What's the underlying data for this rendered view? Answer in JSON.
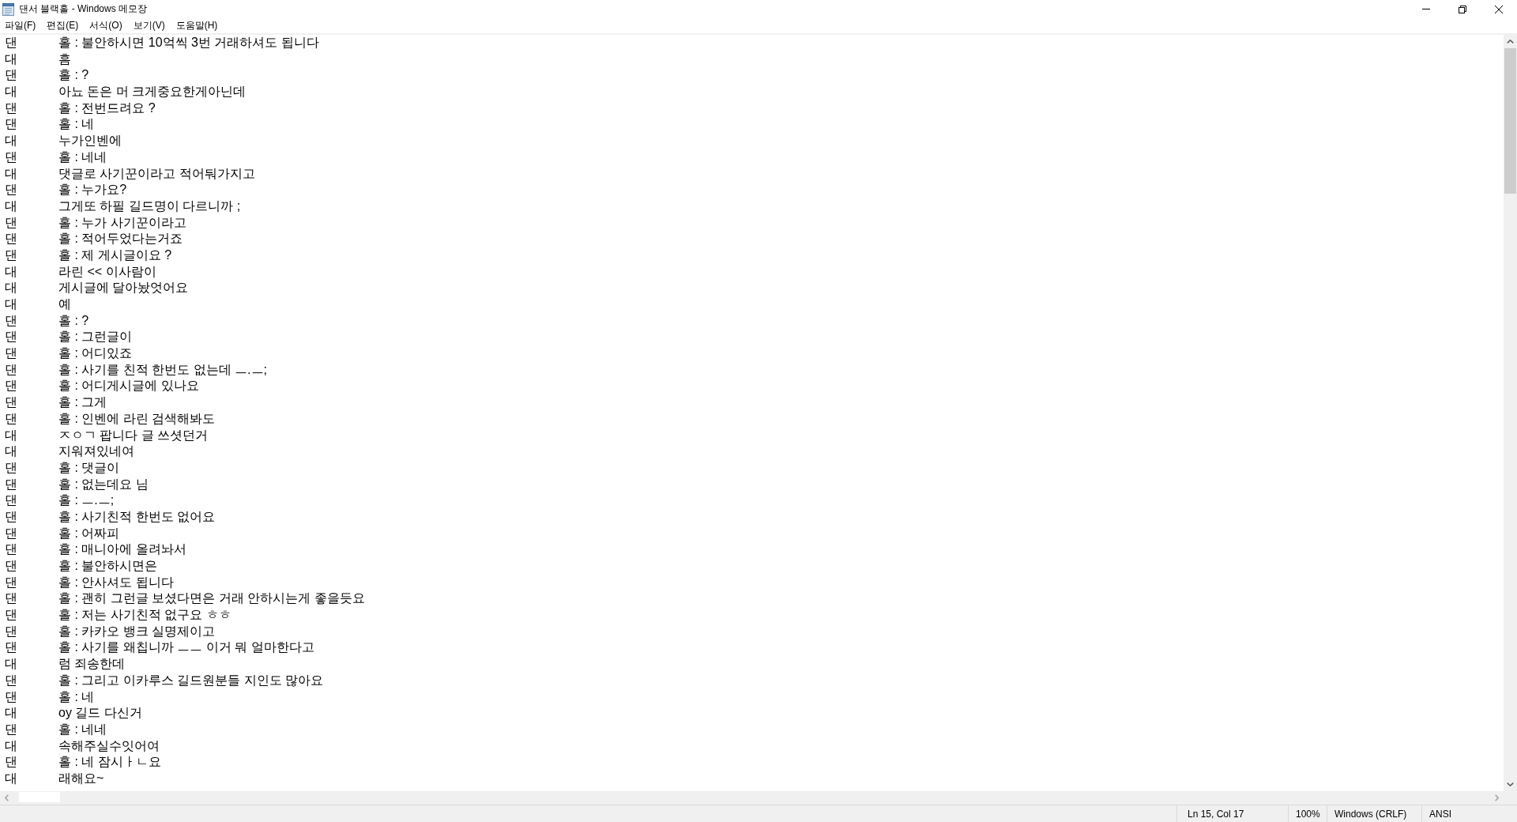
{
  "window": {
    "title": "댄서 블랙홀 - Windows 메모장"
  },
  "menu": [
    "파일(F)",
    "편집(E)",
    "서식(O)",
    "보기(V)",
    "도움말(H)"
  ],
  "lines": [
    {
      "left_text": "댄",
      "right_text": "홀 : 불안하시면 10억씩 3번 거래하셔도 됩니다"
    },
    {
      "left_text": "대",
      "right_text": "흠"
    },
    {
      "left_text": "댄",
      "right_text": "홀 : ?"
    },
    {
      "left_text": "대",
      "right_text": "아뇨 돈은 머 크게중요한게아닌데"
    },
    {
      "left_text": "댄",
      "right_text": "홀 : 전번드려요 ?"
    },
    {
      "left_text": "댄",
      "right_text": "홀 : 네"
    },
    {
      "left_text": "대",
      "right_text": "누가인벤에"
    },
    {
      "left_text": "댄",
      "right_text": "홀 : 네네"
    },
    {
      "left_text": "대",
      "right_text": "댓글로 사기꾼이라고 적어둬가지고"
    },
    {
      "left_text": "댄",
      "right_text": "홀 : 누가요?"
    },
    {
      "left_text": "대",
      "right_text": "그게또 하필 길드명이 다르니까 ;"
    },
    {
      "left_text": "댄",
      "right_text": "홀 : 누가 사기꾼이라고"
    },
    {
      "left_text": "댄",
      "right_text": "홀 : 적어두었다는거죠"
    },
    {
      "left_text": "댄",
      "right_text": "홀 : 제 게시글이요 ?"
    },
    {
      "left_text": "대",
      "right_text": "라린 << 이사람이"
    },
    {
      "left_text": "대",
      "right_text": "게시글에 달아놨엇어요"
    },
    {
      "left_text": "대",
      "right_text": "예"
    },
    {
      "left_text": "댄",
      "right_text": "홀 : ?"
    },
    {
      "left_text": "댄",
      "right_text": "홀 : 그런글이"
    },
    {
      "left_text": "댄",
      "right_text": "홀 : 어디있죠"
    },
    {
      "left_text": "댄",
      "right_text": "홀 : 사기를 친적 한번도 없는데 ㅡ.ㅡ;"
    },
    {
      "left_text": "댄",
      "right_text": "홀 : 어디게시글에 있나요"
    },
    {
      "left_text": "댄",
      "right_text": "홀 : 그게"
    },
    {
      "left_text": "댄",
      "right_text": "홀 : 인벤에 라린 검색해봐도"
    },
    {
      "left_text": "대",
      "right_text": "ㅈㅇㄱ 팝니다 글 쓰셧던거"
    },
    {
      "left_text": "대",
      "right_text": "지워져있네여"
    },
    {
      "left_text": "댄",
      "right_text": "홀 : 댓글이"
    },
    {
      "left_text": "댄",
      "right_text": "홀 : 없는데요 님"
    },
    {
      "left_text": "댄",
      "right_text": "홀 : ㅡ.ㅡ;"
    },
    {
      "left_text": "댄",
      "right_text": "홀 : 사기친적 한번도 없어요"
    },
    {
      "left_text": "댄",
      "right_text": "홀 : 어짜피"
    },
    {
      "left_text": "댄",
      "right_text": "홀 : 매니아에 올려놔서"
    },
    {
      "left_text": "댄",
      "right_text": "홀 : 불안하시면은"
    },
    {
      "left_text": "댄",
      "right_text": "홀 : 안사셔도 됩니다"
    },
    {
      "left_text": "댄",
      "right_text": "홀 : 괜히 그런글 보셨다면은 거래 안하시는게 좋을듯요"
    },
    {
      "left_text": "댄",
      "right_text": "홀 : 저는 사기친적 없구요 ㅎㅎ"
    },
    {
      "left_text": "댄",
      "right_text": "홀 : 카카오 뱅크 실명제이고"
    },
    {
      "left_text": "댄",
      "right_text": "홀 : 사기를 왜칩니까 ㅡㅡ 이거 뭐 얼마한다고"
    },
    {
      "left_text": "대",
      "right_text": "럼 죄송한데"
    },
    {
      "left_text": "댄",
      "right_text": "홀 : 그리고 이카루스 길드원분들 지인도 많아요"
    },
    {
      "left_text": "댄",
      "right_text": "홀 : 네"
    },
    {
      "left_text": "대",
      "right_text": "oy 길드 다신거"
    },
    {
      "left_text": "댄",
      "right_text": "홀 : 네네"
    },
    {
      "left_text": "대",
      "right_text": "속해주실수잇어여"
    },
    {
      "left_text": "댄",
      "right_text": "홀 : 네 잠시ㅏㄴ요"
    },
    {
      "left_text": "대",
      "right_text": "래해요~"
    }
  ],
  "status_bar": {
    "cursor_position": "Ln 15, Col 17",
    "zoom": "100%",
    "line_ending": "Windows (CRLF)",
    "encoding": "ANSI"
  }
}
